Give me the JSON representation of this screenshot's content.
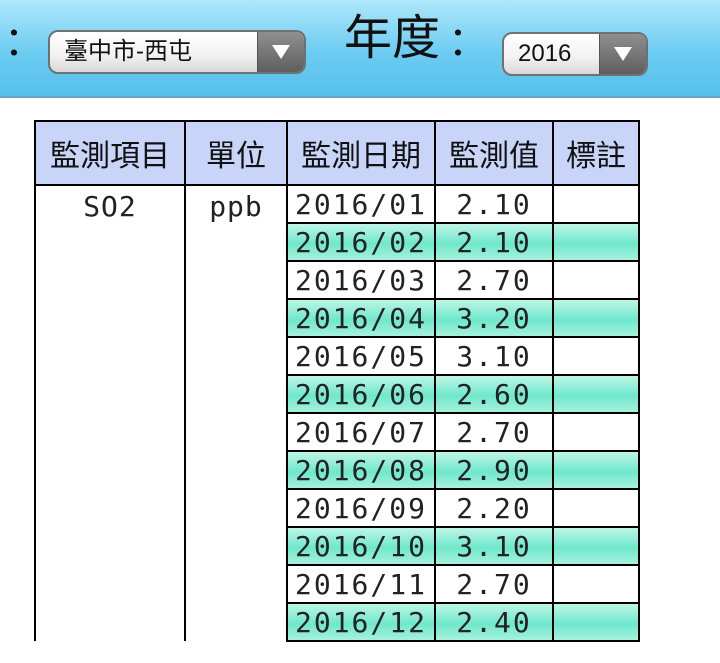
{
  "toolbar": {
    "colon_left": "：",
    "site_select": {
      "value": "臺中市-西屯"
    },
    "year_label": "年度",
    "colon_right": "：",
    "year_select": {
      "value": "2016"
    }
  },
  "table": {
    "headers": [
      "監測項目",
      "單位",
      "監測日期",
      "監測值",
      "標註"
    ],
    "item": "SO2",
    "unit": "ppb",
    "rows": [
      {
        "date": "2016/01",
        "value": "2.10",
        "note": ""
      },
      {
        "date": "2016/02",
        "value": "2.10",
        "note": ""
      },
      {
        "date": "2016/03",
        "value": "2.70",
        "note": ""
      },
      {
        "date": "2016/04",
        "value": "3.20",
        "note": ""
      },
      {
        "date": "2016/05",
        "value": "3.10",
        "note": ""
      },
      {
        "date": "2016/06",
        "value": "2.60",
        "note": ""
      },
      {
        "date": "2016/07",
        "value": "2.70",
        "note": ""
      },
      {
        "date": "2016/08",
        "value": "2.90",
        "note": ""
      },
      {
        "date": "2016/09",
        "value": "2.20",
        "note": ""
      },
      {
        "date": "2016/10",
        "value": "3.10",
        "note": ""
      },
      {
        "date": "2016/11",
        "value": "2.70",
        "note": ""
      },
      {
        "date": "2016/12",
        "value": "2.40",
        "note": ""
      }
    ]
  }
}
